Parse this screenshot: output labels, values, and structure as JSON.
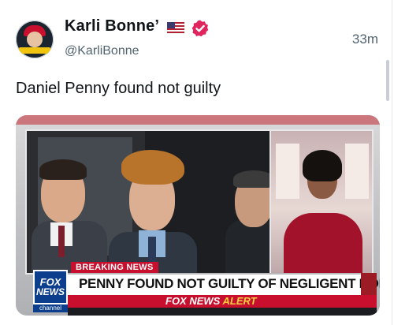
{
  "post": {
    "display_name": "Karli Bonne’",
    "handle": "@KarliBonne",
    "timestamp": "33m",
    "text": "Daniel Penny found not guilty",
    "flag_icon": "us-flag-icon",
    "verified_icon": "verified-badge-icon",
    "verified_color": "#e0245e"
  },
  "media": {
    "banner": {
      "breaking_label": "BREAKING NEWS",
      "headline": "PENNY FOUND NOT GUILTY OF NEGLIGENT HOMICIDE",
      "alert_prefix": "FOX NEWS",
      "alert_suffix": "ALERT"
    },
    "logo": {
      "line1": "FOX",
      "line2": "NEWS",
      "line3": "channel"
    }
  },
  "colors": {
    "fox_blue": "#0b3e8c",
    "breaking_red": "#c8102e",
    "alert_yellow": "#ffd23f"
  }
}
